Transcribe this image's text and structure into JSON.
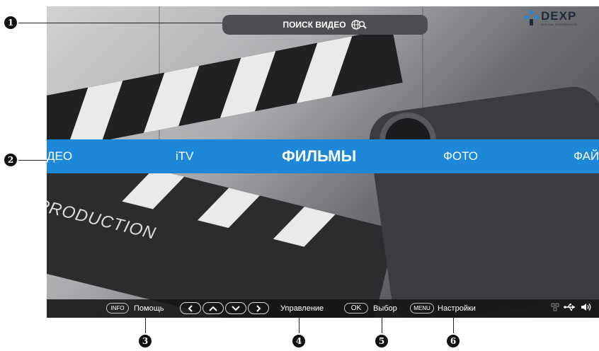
{
  "search": {
    "label": "ПОИСК ВИДЕО"
  },
  "logo": {
    "word": "DEXP",
    "tagline": "DIGITAL EXPERIENCE"
  },
  "menu": {
    "items": [
      {
        "label": "ДЕО"
      },
      {
        "label": "iTV"
      },
      {
        "label": "ФИЛЬМЫ",
        "active": true
      },
      {
        "label": "ФОТО"
      },
      {
        "label": "ФАЙ"
      }
    ]
  },
  "background": {
    "text": "PRODUCTION"
  },
  "hints": {
    "info_key": "INFO",
    "help": "Помощь",
    "control": "Управление",
    "ok_key": "OK",
    "select": "Выбор",
    "menu_key": "MENU",
    "settings": "Настройки"
  },
  "callouts": [
    "1",
    "2",
    "3",
    "4",
    "5",
    "6"
  ],
  "colors": {
    "menu_bar": "#1e88d8",
    "search_pill": "#4b4f51",
    "hint_bar": "#141416"
  },
  "icons": [
    "globe-search-icon",
    "network-icon",
    "usb-icon",
    "volume-icon",
    "arrow-left-icon",
    "arrow-up-icon",
    "arrow-down-icon",
    "arrow-right-icon"
  ]
}
